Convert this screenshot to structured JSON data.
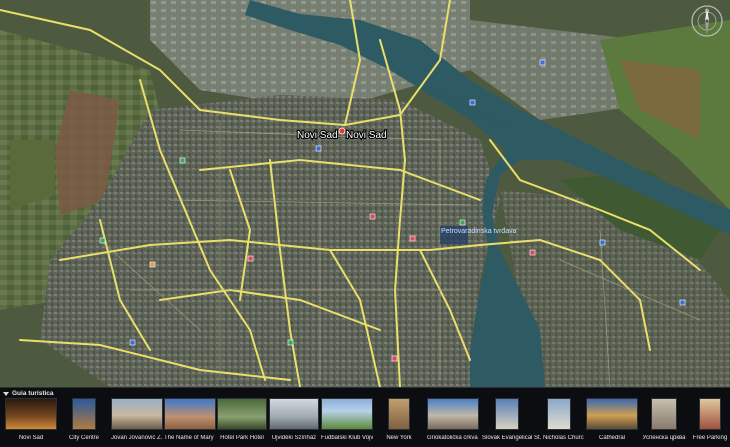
{
  "map": {
    "city_label": "Novi Sad",
    "poi_label": "Petrovaradinska tvrđava"
  },
  "compass": {
    "icon": "compass-icon"
  },
  "tour": {
    "title": "Guia turística",
    "items": [
      {
        "caption": "Novi Sad"
      },
      {
        "caption": "City Centre"
      },
      {
        "caption": "Jovan Jovanović Z..."
      },
      {
        "caption": "The Name of Mary ..."
      },
      {
        "caption": "Hotel Park Hotel"
      },
      {
        "caption": "Ujvidéki Színház"
      },
      {
        "caption": "Fudbalski Klub Vojvo..."
      },
      {
        "caption": "New York"
      },
      {
        "caption": "Griokatolička crkva ..."
      },
      {
        "caption": "Slovak Evangelical C..."
      },
      {
        "caption": "St. Nicholas Church"
      },
      {
        "caption": "Cathedral"
      },
      {
        "caption": "Успенска црква"
      },
      {
        "caption": "Free Parking"
      }
    ]
  }
}
